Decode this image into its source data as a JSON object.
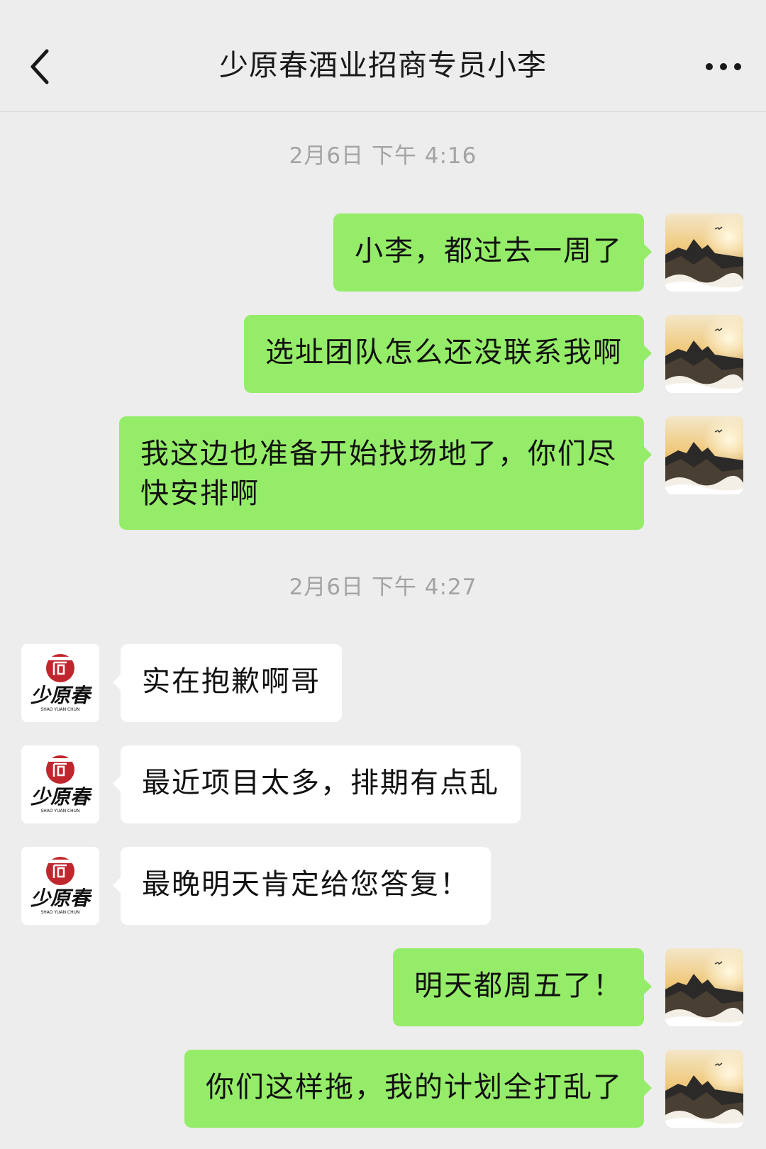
{
  "header": {
    "title": "少原春酒业招商专员小李",
    "back_icon": "chevron-left-icon",
    "more_icon": "more-horizontal-icon"
  },
  "contact": {
    "logo_text": "少原春",
    "logo_sub": "SHAO YUAN CHUN"
  },
  "timestamps": [
    "2月6日 下午 4:16",
    "2月6日 下午 4:27"
  ],
  "messages": [
    {
      "from": "me",
      "text": "小李，都过去一周了"
    },
    {
      "from": "me",
      "text": "选址团队怎么还没联系我啊"
    },
    {
      "from": "me",
      "text": "我这边也准备开始找场地了，你们尽快安排啊"
    },
    {
      "from": "them",
      "text": "实在抱歉啊哥"
    },
    {
      "from": "them",
      "text": "最近项目太多，排期有点乱"
    },
    {
      "from": "them",
      "text": "最晚明天肯定给您答复！"
    },
    {
      "from": "me",
      "text": "明天都周五了！"
    },
    {
      "from": "me",
      "text": "你们这样拖，我的计划全打乱了"
    }
  ],
  "colors": {
    "background": "#ededed",
    "my_bubble": "#95ec69",
    "their_bubble": "#ffffff",
    "timestamp": "#a3a3a3",
    "brand_red": "#c0262d"
  }
}
